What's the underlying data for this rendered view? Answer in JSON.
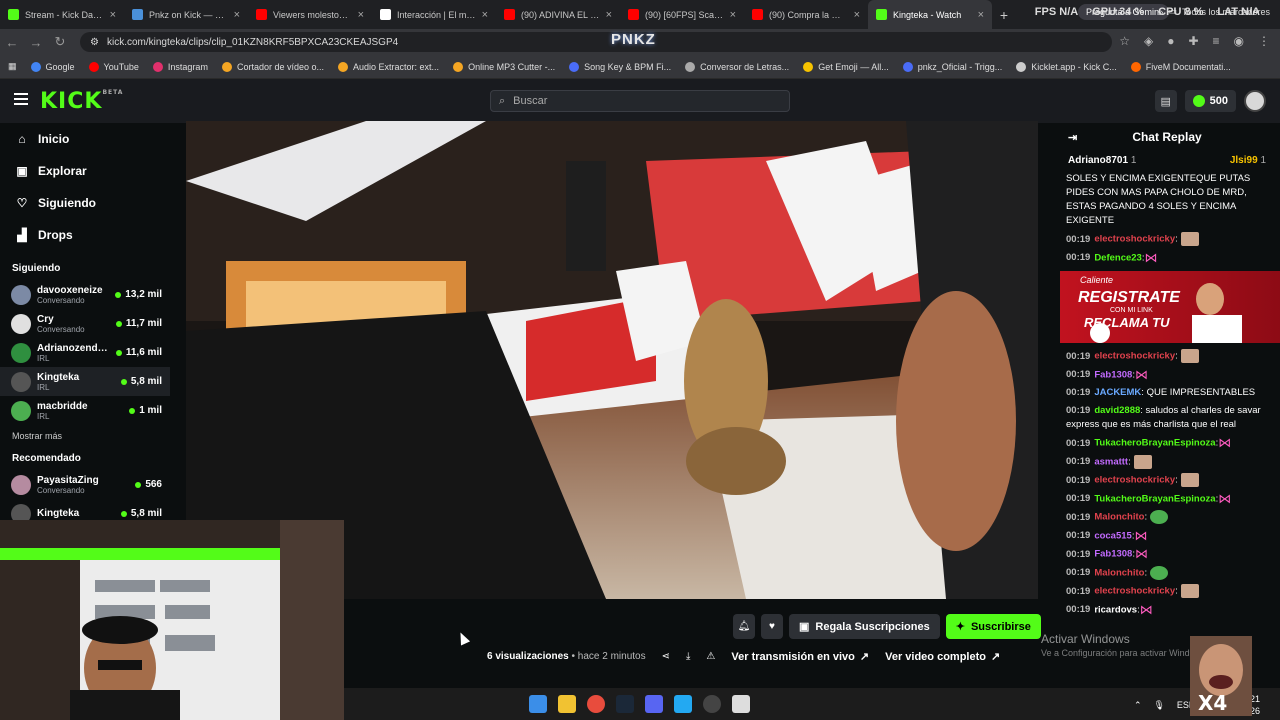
{
  "browser": {
    "tabs": [
      {
        "title": "Stream - Kick Dashbo",
        "color": "#53fc18"
      },
      {
        "title": "Pnkz on Kick — Enga",
        "color": "#4a90d9"
      },
      {
        "title": "Viewers molestos con",
        "color": "#ff0000"
      },
      {
        "title": "Interacción | El mejor",
        "color": "#ffffff"
      },
      {
        "title": "(90) ADIVINA EL PITU",
        "color": "#ff0000"
      },
      {
        "title": "(90) [60FPS] Scarface",
        "color": "#ff0000"
      },
      {
        "title": "(90) Compra la mejor",
        "color": "#ff0000"
      },
      {
        "title": "Kingteka - Watch",
        "color": "#53fc18"
      }
    ],
    "new_tab": "+",
    "gemini": "Pregunta a Gemini",
    "stats": {
      "fps": "FPS N/A",
      "gpu": "GPU 34 %",
      "cpu": "CPU 8 %",
      "lat": "LAT N/A"
    },
    "url": "kick.com/kingteka/clips/clip_01KZN8KRF5BPXCA23CKEAJSGP4",
    "overlay_logo": "PNKZ",
    "bookmarks": [
      {
        "label": "Google",
        "color": "#4285f4"
      },
      {
        "label": "YouTube",
        "color": "#ff0000"
      },
      {
        "label": "Instagram",
        "color": "#e1306c"
      },
      {
        "label": "Cortador de vídeo o...",
        "color": "#f5a623"
      },
      {
        "label": "Audio Extractor: ext...",
        "color": "#f5a623"
      },
      {
        "label": "Online MP3 Cutter -...",
        "color": "#f5a623"
      },
      {
        "label": "Song Key & BPM Fi...",
        "color": "#4a6cf7"
      },
      {
        "label": "Conversor de Letras...",
        "color": "#aaaaaa"
      },
      {
        "label": "Get Emoji — All...",
        "color": "#f7c300"
      },
      {
        "label": "pnkz_Oficial - Trigg...",
        "color": "#4a6cf7"
      },
      {
        "label": "Kicklet.app - Kick C...",
        "color": "#cccccc"
      },
      {
        "label": "FiveM Documentati...",
        "color": "#ff6600"
      }
    ],
    "bookmarks_more": "»",
    "all_bookmarks": "Todos los marcadores"
  },
  "kick": {
    "logo": "KICK",
    "beta": "BETA",
    "search_placeholder": "Buscar",
    "points": "500",
    "nav": [
      {
        "label": "Inicio",
        "icon": "home-icon",
        "glyph": "⌂"
      },
      {
        "label": "Explorar",
        "icon": "compass-icon",
        "glyph": "▣"
      },
      {
        "label": "Siguiendo",
        "icon": "heart-icon",
        "glyph": "♡"
      },
      {
        "label": "Drops",
        "icon": "drops-icon",
        "glyph": "▟"
      }
    ],
    "following_title": "Siguiendo",
    "following": [
      {
        "name": "davooxeneize",
        "cat": "Conversando",
        "viewers": "13,2 mil",
        "color": "#7c8aa5"
      },
      {
        "name": "Cry",
        "cat": "Conversando",
        "viewers": "11,7 mil",
        "color": "#e0e0e0"
      },
      {
        "name": "Adrianozendej...",
        "cat": "IRL",
        "viewers": "11,6 mil",
        "color": "#2f8f3f"
      },
      {
        "name": "Kingteka",
        "cat": "IRL",
        "viewers": "5,8 mil",
        "color": "#555555"
      },
      {
        "name": "macbridde",
        "cat": "IRL",
        "viewers": "1 mil",
        "color": "#4caf50"
      }
    ],
    "show_more": "Mostrar más",
    "recommended_title": "Recomendado",
    "recommended": [
      {
        "name": "PayasitaZing",
        "cat": "Conversando",
        "viewers": "566",
        "color": "#b58ba0"
      },
      {
        "name": "Kingteka",
        "cat": "",
        "viewers": "5,8 mil",
        "color": "#555555"
      }
    ],
    "actions": {
      "bell": "bell-icon",
      "heart": "heart-icon",
      "gift_label": "Regala Suscripciones",
      "subscribe_label": "Suscribirse"
    },
    "clip_meta": {
      "views_count": "6",
      "views_label": "visualizaciones",
      "ago": "• hace 2 minutos",
      "live_link": "Ver transmisión en vivo",
      "full_link": "Ver video completo"
    }
  },
  "chat": {
    "title": "Chat Replay",
    "pinned_left": "Adriano8701",
    "pinned_left_count": "1",
    "pinned_right": "Jlsi99",
    "pinned_right_count": "1",
    "messages_top": [
      {
        "time": "",
        "user": "",
        "color": "#ffffff",
        "text": "SOLES Y ENCIMA EXIGENTEQUE PUTAS PIDES CON MAS PAPA CHOLO DE MRD, ESTAS PAGANDO 4 SOLES Y ENCIMA EXIGENTE",
        "emote": ""
      },
      {
        "time": "00:19",
        "user": "electroshockricky",
        "color": "#e0424d",
        "text": ":",
        "emote": "face"
      },
      {
        "time": "00:19",
        "user": "Defence23",
        "color": "#53fc18",
        "text": ":",
        "emote": "bow"
      }
    ],
    "ad": {
      "line1": "Caliente",
      "line2": "REGISTRATE",
      "line3": "CON MI LINK",
      "line4": "RECLAMA TU"
    },
    "messages": [
      {
        "time": "00:19",
        "user": "electroshockricky",
        "color": "#e0424d",
        "text": ":",
        "emote": "face"
      },
      {
        "time": "00:19",
        "user": "Fab1308",
        "color": "#c36bff",
        "text": ":",
        "emote": "bow"
      },
      {
        "time": "00:19",
        "user": "JACKEMK",
        "color": "#6aa9ff",
        "text": ": QUE IMPRESENTABLES",
        "emote": ""
      },
      {
        "time": "00:19",
        "user": "david2888",
        "color": "#53fc18",
        "text": ": saludos al charles de savar express que es más charlista que el real",
        "emote": ""
      },
      {
        "time": "00:19",
        "user": "TukacheroBrayanEspinoza",
        "color": "#53fc18",
        "text": ":",
        "emote": "bow"
      },
      {
        "time": "00:19",
        "user": "asmattt",
        "color": "#c36bff",
        "text": ":",
        "emote": "face"
      },
      {
        "time": "00:19",
        "user": "electroshockricky",
        "color": "#e0424d",
        "text": ":",
        "emote": "face"
      },
      {
        "time": "00:19",
        "user": "TukacheroBrayanEspinoza",
        "color": "#53fc18",
        "text": ":",
        "emote": "bow"
      },
      {
        "time": "00:19",
        "user": "Malonchito",
        "color": "#e0424d",
        "text": ":",
        "emote": "pepe"
      },
      {
        "time": "00:19",
        "user": "coca515",
        "color": "#c36bff",
        "text": ":",
        "emote": "bow"
      },
      {
        "time": "00:19",
        "user": "Fab1308",
        "color": "#c36bff",
        "text": ":",
        "emote": "bow"
      },
      {
        "time": "00:19",
        "user": "Malonchito",
        "color": "#e0424d",
        "text": ":",
        "emote": "pepe"
      },
      {
        "time": "00:19",
        "user": "electroshockricky",
        "color": "#e0424d",
        "text": ":",
        "emote": "face"
      },
      {
        "time": "00:19",
        "user": "ricardovs",
        "color": "#ffffff",
        "text": ":",
        "emote": "bow"
      }
    ]
  },
  "windows": {
    "activate": "Activar Windows",
    "activate_sub": "Ve a Configuración para activar Windows.",
    "lang": "ESP",
    "time": "2:21",
    "date": "08/2026",
    "x4": "X4"
  }
}
